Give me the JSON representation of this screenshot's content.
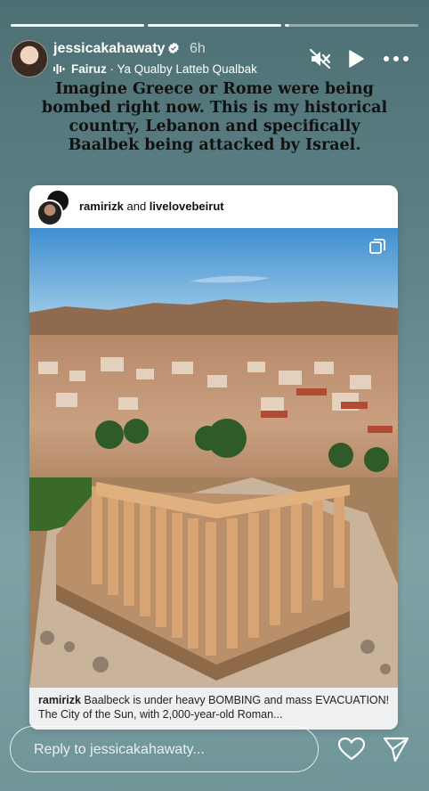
{
  "progress": {
    "segments": 3,
    "completed": 2,
    "current_fraction": 0.03
  },
  "header": {
    "username": "jessicakahawaty",
    "time": "6h",
    "music_artist": "Fairuz",
    "music_title": "· Ya Qualby Latteb Qualbak",
    "icons": [
      "verified-icon",
      "music-icon",
      "mute-icon",
      "play-icon",
      "more-icon"
    ]
  },
  "caption": {
    "line1": "Imagine Greece or Rome were being",
    "line2": "bombed right now. This is my historical",
    "line3": "country, Lebanon and specifically",
    "line4": "Baalbek being attacked by Israel."
  },
  "shared_post": {
    "user1": "ramirizk",
    "joiner": " and ",
    "user2": "livelovebeirut",
    "caption_user": "ramirizk",
    "caption_text": " Baalbeck is under heavy BOMBING and mass EVACUATION! The City of the Sun, with 2,000-year-old Roman..."
  },
  "reply": {
    "placeholder": "Reply to jessicakahawaty..."
  },
  "colors": {
    "accent": "#ffffff",
    "caption_text": "#111111",
    "background": "#5f8589"
  }
}
